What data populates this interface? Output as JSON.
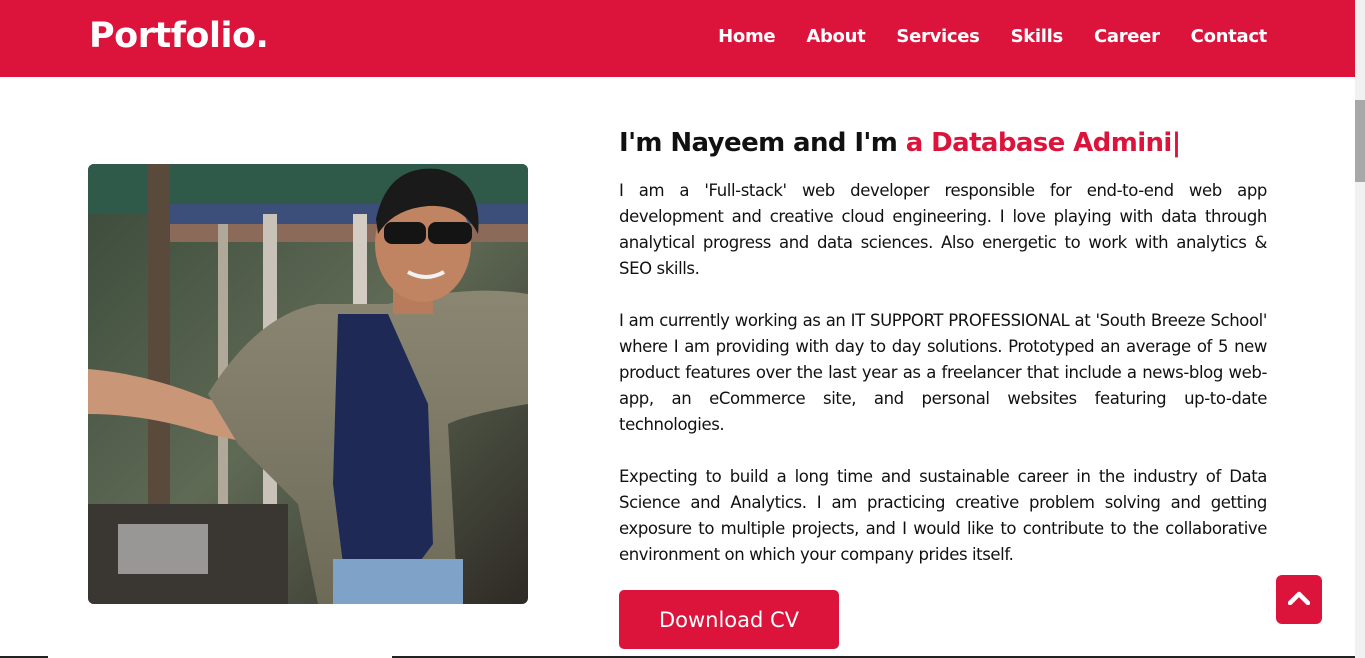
{
  "nav": {
    "logo": "Portfolio.",
    "items": [
      "Home",
      "About",
      "Services",
      "Skills",
      "Career",
      "Contact"
    ]
  },
  "about": {
    "headline_prefix": "I'm Nayeem and I'm ",
    "headline_typed": "a Database Admini",
    "cursor": "|",
    "paragraphs": [
      "I am a 'Full-stack' web developer responsible for end-to-end web app development and creative cloud engineering. I love playing with data through analytical progress and data sciences. Also energetic to work with analytics & SEO skills.",
      "I am currently working as an IT SUPPORT PROFESSIONAL at 'South Breeze School' where I am providing with day to day solutions. Prototyped an average of 5 new product features over the last year as a freelancer that include a news-blog web-app, an eCommerce site, and personal websites featuring up-to-date technologies.",
      "Expecting to build a long time and sustainable career in the industry of Data Science and Analytics. I am practicing creative problem solving and getting exposure to multiple projects, and I would like to contribute to the collaborative environment on which your company prides itself."
    ],
    "cv_button": "Download CV"
  },
  "icons": {
    "scroll_top": "chevron-up-icon"
  },
  "colors": {
    "accent": "#dc143c",
    "text": "#111111",
    "background": "#ffffff"
  }
}
